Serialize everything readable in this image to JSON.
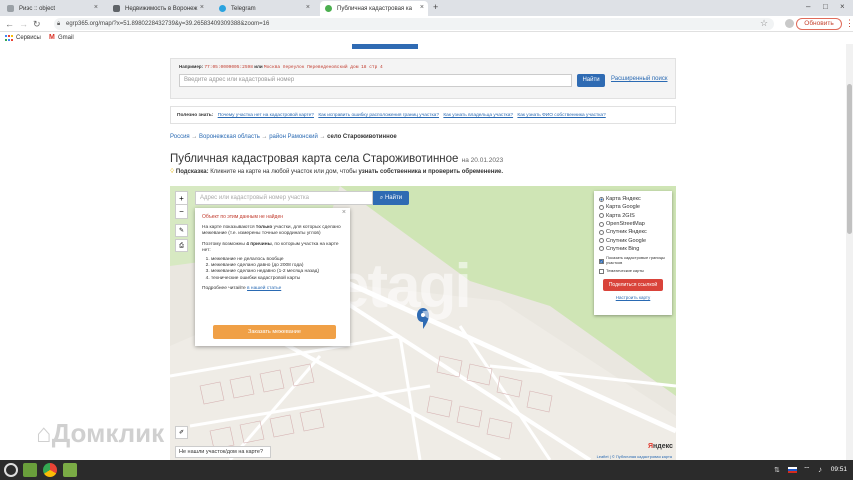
{
  "browser": {
    "tabs": [
      {
        "label": "Риэс :: object",
        "color": "#9aa0a6",
        "active": false
      },
      {
        "label": "Недвижимость в Воронеж",
        "color": "#5f6368",
        "active": false
      },
      {
        "label": "Telegram",
        "color": "#2aa3df",
        "active": false
      },
      {
        "label": "Публичная кадастровая ка",
        "color": "#4caf50",
        "active": true
      }
    ],
    "new_tab": "+",
    "url": "egrp365.org/map/?x=51.8980228432739&y=39.26583409309388&zoom=16",
    "update_button": "Обновить",
    "bookmarks": [
      {
        "label": "Сервисы"
      },
      {
        "label": "Gmail"
      }
    ]
  },
  "site": {
    "search_example_prefix": "Например:",
    "search_example_code": "77:05:0009005:2598",
    "search_example_or": "или",
    "search_example_address": "Москва переулок Переведеновский дом 18 стр 4",
    "search_placeholder": "Введите адрес или кадастровый номер",
    "search_button": "Найти",
    "advanced_search": "Расширенный поиск",
    "useful_label": "Полезно знать:",
    "useful_links": [
      "Почему участка нет на кадастровой карте?",
      "Как исправить ошибку расположения границ участка?",
      "Как узнать владельца участка?",
      "Как узнать ФИО собственника участка?"
    ],
    "breadcrumbs": [
      "Россия",
      "Воронежская область",
      "район Рамонский",
      "село Староживотинное"
    ],
    "title": "Публичная кадастровая карта села Староживотинное",
    "title_date": "на 20.01.2023",
    "tip_label": "Подсказка:",
    "tip_text": "Кликните на карте на любой участок или дом, чтобы",
    "tip_bold": "узнать собственника и проверить обременение."
  },
  "map": {
    "search_placeholder": "Адрес или кадастровый номер участка",
    "search_button": "Найти",
    "zoom_in": "+",
    "zoom_out": "−",
    "popup": {
      "title": "Объект по этим данным не найден",
      "p1_a": "На карте показываются",
      "p1_b": "только",
      "p1_c": "участки, для которых сделано межевание (т.е. измерены точные координаты углов)",
      "p2_a": "Поэтому возможны",
      "p2_b": "4 причины",
      "p2_c": ", по которым участка на карте нет:",
      "reasons": [
        "межевание не делалось вообще",
        "межевание сделано давно (до 2008 года)",
        "межевание сделано недавно (1-2 месяца назад)",
        "технические ошибки кадастровой карты"
      ],
      "more_prefix": "Подробнее читайте",
      "more_link": "в нашей статье",
      "order_button": "Заказать межевание"
    },
    "layers": {
      "options": [
        {
          "label": "Карта Яндекс",
          "selected": true
        },
        {
          "label": "Карта Google",
          "selected": false
        },
        {
          "label": "Карта 2GIS",
          "selected": false
        },
        {
          "label": "OpenStreetMap",
          "selected": false
        },
        {
          "label": "Спутник Яндекс",
          "selected": false
        },
        {
          "label": "Спутник Google",
          "selected": false
        },
        {
          "label": "Спутник Bing",
          "selected": false
        }
      ],
      "checkboxes": [
        {
          "label": "Показать кадастровые границы участков",
          "checked": true
        },
        {
          "label": "Тематические карты",
          "checked": false
        }
      ],
      "share_button": "Поделиться ссылкой",
      "setup_link": "Настроить карту"
    },
    "not_found_button": "Не нашли участок/дом на карте?",
    "watermark": "etagi",
    "credits": "Leaflet | © Публичная кадастровая карта",
    "yandex_logo_y": "Я",
    "yandex_logo_rest": "ндекс",
    "pin_color": "#2f6bb3"
  },
  "overlay_watermark": "Домклик",
  "taskbar": {
    "clock": "09:51"
  }
}
